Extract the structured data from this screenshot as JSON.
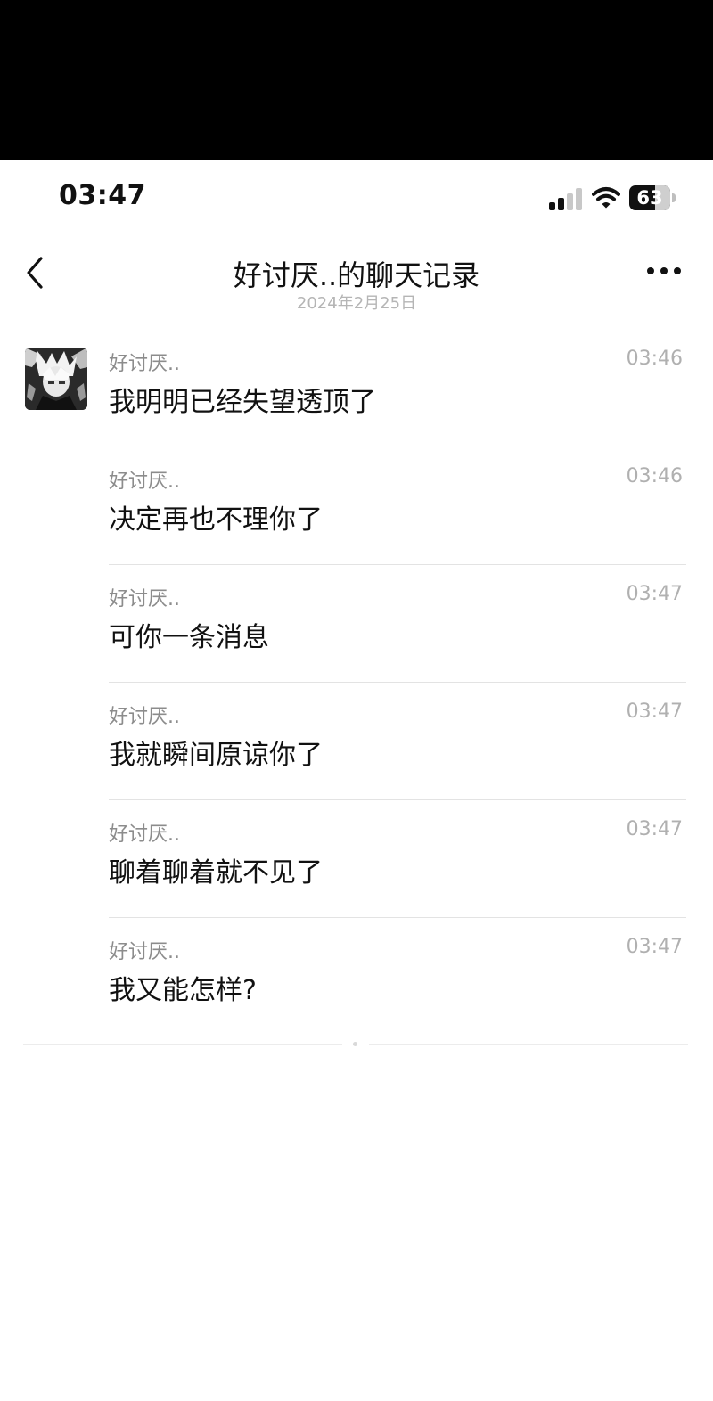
{
  "status_bar": {
    "time": "03:47",
    "battery_level": "63",
    "signal_bars": 2,
    "icons": [
      "signal-icon",
      "wifi-icon",
      "battery-icon"
    ]
  },
  "header": {
    "title": "好讨厌..的聊天记录",
    "subtitle": "2024年2月25日",
    "back_icon": "chevron-left-icon",
    "more_icon": "more-horizontal-icon"
  },
  "messages": [
    {
      "sender": "好讨厌..",
      "time": "03:46",
      "text": "我明明已经失望透顶了"
    },
    {
      "sender": "好讨厌..",
      "time": "03:46",
      "text": "决定再也不理你了"
    },
    {
      "sender": "好讨厌..",
      "time": "03:47",
      "text": "可你一条消息"
    },
    {
      "sender": "好讨厌..",
      "time": "03:47",
      "text": "我就瞬间原谅你了"
    },
    {
      "sender": "好讨厌..",
      "time": "03:47",
      "text": "聊着聊着就不见了"
    },
    {
      "sender": "好讨厌..",
      "time": "03:47",
      "text": "我又能怎样?"
    }
  ],
  "colors": {
    "background": "#ffffff",
    "top_bar": "#000000",
    "text_primary": "#111111",
    "text_secondary": "#8c8c8c",
    "divider": "#e3e3e3"
  }
}
